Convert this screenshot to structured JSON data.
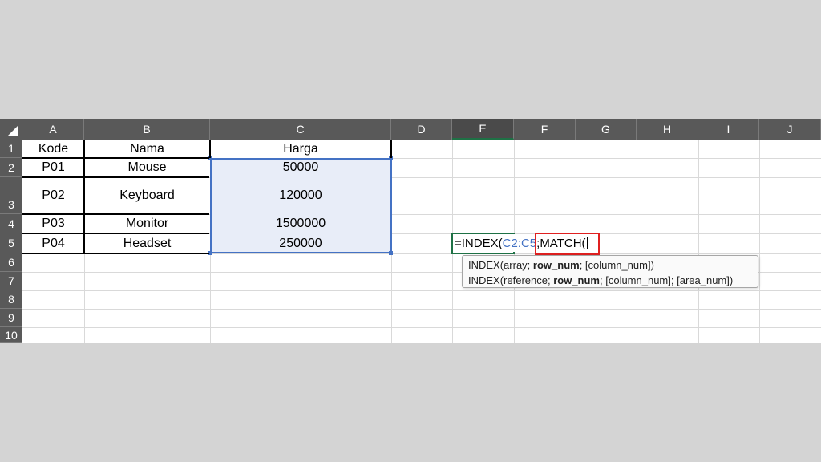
{
  "columns": [
    "A",
    "B",
    "C",
    "D",
    "E",
    "F",
    "G",
    "H",
    "I",
    "J"
  ],
  "rows": [
    "1",
    "2",
    "3",
    "4",
    "5",
    "6",
    "7",
    "8",
    "9",
    "10"
  ],
  "table": {
    "headers": [
      "Kode",
      "Nama",
      "Harga"
    ],
    "data": [
      [
        "P01",
        "Mouse",
        "50000"
      ],
      [
        "P02",
        "Keyboard",
        "120000"
      ],
      [
        "P03",
        "Monitor",
        "1500000"
      ],
      [
        "P04",
        "Headset",
        "250000"
      ]
    ]
  },
  "formula": {
    "prefix": "=INDEX(",
    "ref": "C2:C5",
    "sep": ";",
    "match": "MATCH("
  },
  "tooltip": {
    "line1": {
      "a": "INDEX(array; ",
      "b": "row_num",
      "c": "; [column_num])"
    },
    "line2": {
      "a": "INDEX(reference; ",
      "b": "row_num",
      "c": "; [column_num]; [area_num])"
    }
  },
  "colors": {
    "header_bg": "#595959",
    "selection_border": "#4472c4",
    "selection_fill": "#e8edf8",
    "active_cell_border": "#1e7145",
    "highlight_box": "#e02020"
  }
}
